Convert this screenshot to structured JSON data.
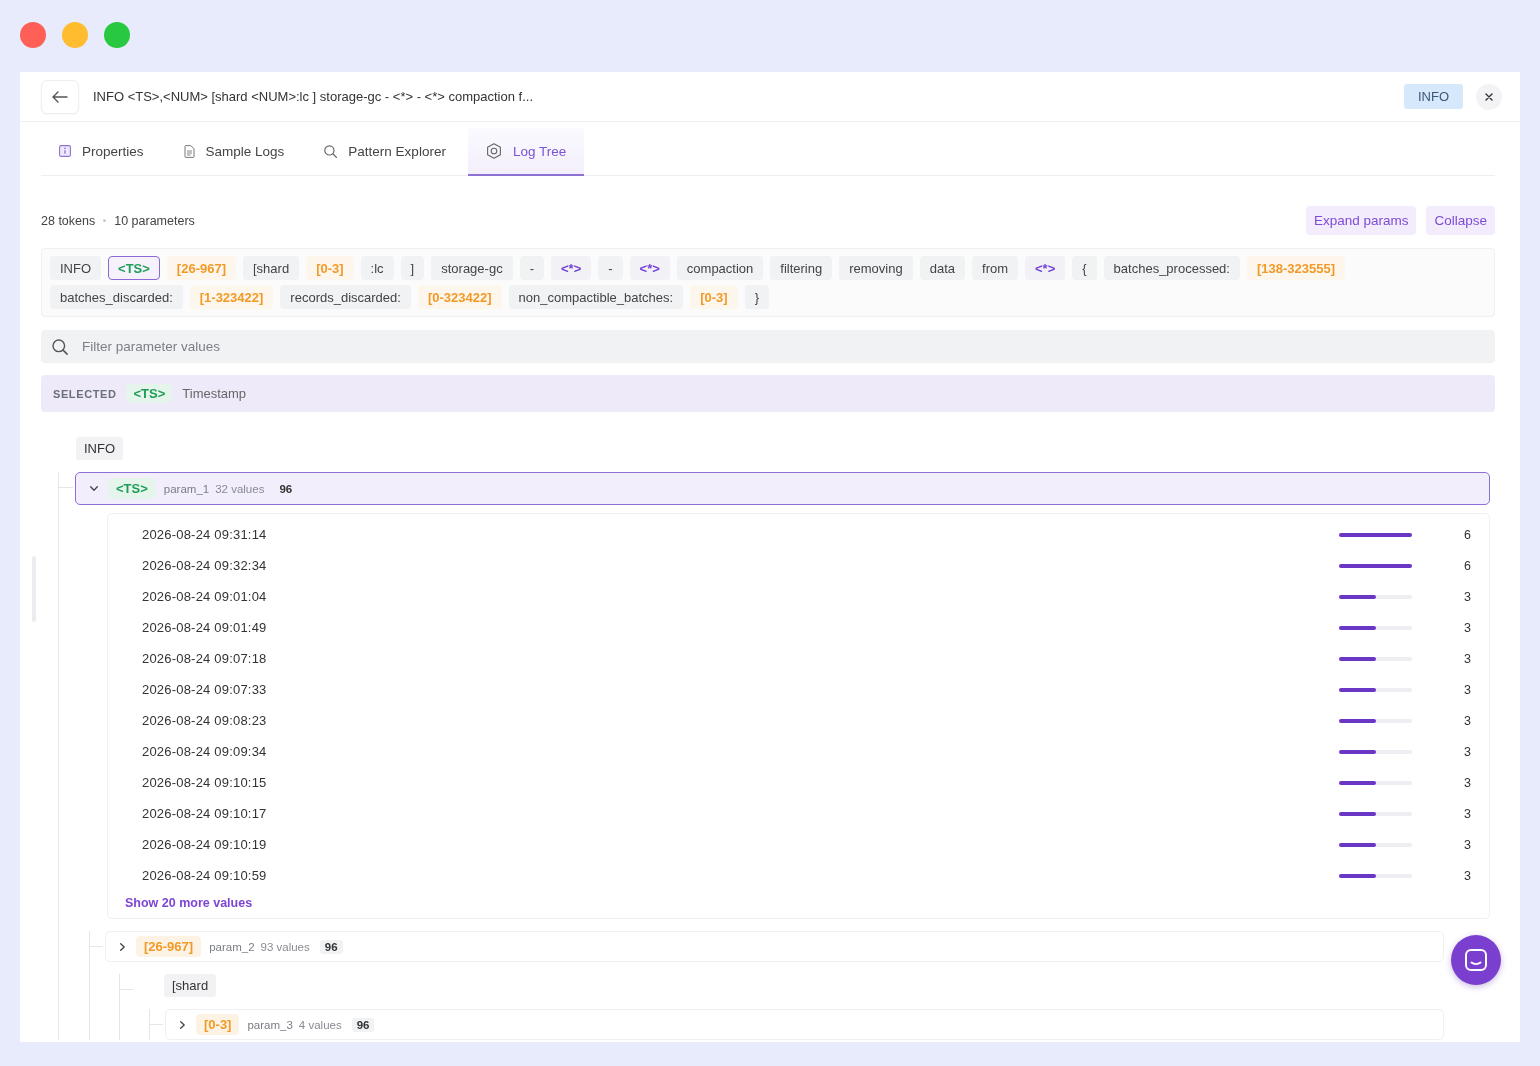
{
  "header": {
    "title": "INFO <TS>,<NUM> [shard <NUM>:lc ] storage-gc - <*> - <*> compaction f...",
    "badge": "INFO"
  },
  "tabs": [
    {
      "label": "Properties",
      "selected": false
    },
    {
      "label": "Sample Logs",
      "selected": false
    },
    {
      "label": "Pattern Explorer",
      "selected": false
    },
    {
      "label": "Log Tree",
      "selected": true
    }
  ],
  "stats": {
    "tokens": "28 tokens",
    "parameters": "10 parameters"
  },
  "actions": [
    "Expand params",
    "Collapse"
  ],
  "token_rows": [
    [
      {
        "kind": "text",
        "label": "INFO",
        "selected": false
      },
      {
        "kind": "timestamp",
        "label": "<TS>",
        "selected": true
      },
      {
        "kind": "range",
        "label": "[26-967]",
        "selected": false
      },
      {
        "kind": "text",
        "label": "[shard",
        "selected": false
      },
      {
        "kind": "range",
        "label": "[0-3]",
        "selected": false
      },
      {
        "kind": "text",
        "label": ":lc",
        "selected": false
      },
      {
        "kind": "text",
        "label": "]",
        "selected": false
      },
      {
        "kind": "text",
        "label": "storage-gc",
        "selected": false
      },
      {
        "kind": "text",
        "label": "-",
        "selected": false
      },
      {
        "kind": "wildcard",
        "label": "<*>",
        "selected": false
      },
      {
        "kind": "text",
        "label": "-",
        "selected": false
      },
      {
        "kind": "wildcard",
        "label": "<*>",
        "selected": false
      },
      {
        "kind": "text",
        "label": "compaction",
        "selected": false
      },
      {
        "kind": "text",
        "label": "filtering",
        "selected": false
      },
      {
        "kind": "text",
        "label": "removing",
        "selected": false
      },
      {
        "kind": "text",
        "label": "data",
        "selected": false
      },
      {
        "kind": "text",
        "label": "from",
        "selected": false
      },
      {
        "kind": "wildcard",
        "label": "<*>",
        "selected": false
      },
      {
        "kind": "text",
        "label": "{",
        "selected": false
      },
      {
        "kind": "text",
        "label": "batches_processed:",
        "selected": false
      },
      {
        "kind": "range",
        "label": "[138-323555]",
        "selected": false
      }
    ],
    [
      {
        "kind": "text",
        "label": "batches_discarded:",
        "selected": false
      },
      {
        "kind": "range",
        "label": "[1-323422]",
        "selected": false
      },
      {
        "kind": "text",
        "label": "records_discarded:",
        "selected": false
      },
      {
        "kind": "range",
        "label": "[0-323422]",
        "selected": false
      },
      {
        "kind": "text",
        "label": "non_compactible_batches:",
        "selected": false
      },
      {
        "kind": "range",
        "label": "[0-3]",
        "selected": false
      },
      {
        "kind": "text",
        "label": "}",
        "selected": false
      }
    ]
  ],
  "filter": {
    "placeholder": "Filter parameter values"
  },
  "selection": {
    "label": "SELECTED",
    "token": {
      "kind": "timestamp",
      "label": "<TS>"
    },
    "name": "Timestamp"
  },
  "tree": [
    {
      "kind": "literal",
      "label": "INFO",
      "children": [
        {
          "kind": "param",
          "token": {
            "kind": "timestamp",
            "label": "<TS>"
          },
          "param": "param_1",
          "values_count": "32 values",
          "total": "96",
          "selected": true,
          "expanded": true,
          "values": [
            {
              "value": "2026-08-24 09:31:14",
              "count": "6",
              "level": 1
            },
            {
              "value": "2026-08-24 09:32:34",
              "count": "6",
              "level": 1
            },
            {
              "value": "2026-08-24 09:01:04",
              "count": "3",
              "level": 0.5
            },
            {
              "value": "2026-08-24 09:01:49",
              "count": "3",
              "level": 0.5
            },
            {
              "value": "2026-08-24 09:07:18",
              "count": "3",
              "level": 0.5
            },
            {
              "value": "2026-08-24 09:07:33",
              "count": "3",
              "level": 0.5
            },
            {
              "value": "2026-08-24 09:08:23",
              "count": "3",
              "level": 0.5
            },
            {
              "value": "2026-08-24 09:09:34",
              "count": "3",
              "level": 0.5
            },
            {
              "value": "2026-08-24 09:10:15",
              "count": "3",
              "level": 0.5
            },
            {
              "value": "2026-08-24 09:10:17",
              "count": "3",
              "level": 0.5
            },
            {
              "value": "2026-08-24 09:10:19",
              "count": "3",
              "level": 0.5
            },
            {
              "value": "2026-08-24 09:10:59",
              "count": "3",
              "level": 0.5
            }
          ],
          "more": "Show 20 more values",
          "children": [
            {
              "kind": "param",
              "token": {
                "kind": "range",
                "label": "[26-967]"
              },
              "param": "param_2",
              "values_count": "93 values",
              "total": "96",
              "selected": false,
              "expanded": false,
              "children": [
                {
                  "kind": "literal",
                  "label": "[shard",
                  "children": [
                    {
                      "kind": "param",
                      "token": {
                        "kind": "range",
                        "label": "[0-3]"
                      },
                      "param": "param_3",
                      "values_count": "4 values",
                      "total": "96",
                      "selected": false,
                      "expanded": false
                    }
                  ]
                }
              ]
            }
          ]
        }
      ]
    }
  ]
}
